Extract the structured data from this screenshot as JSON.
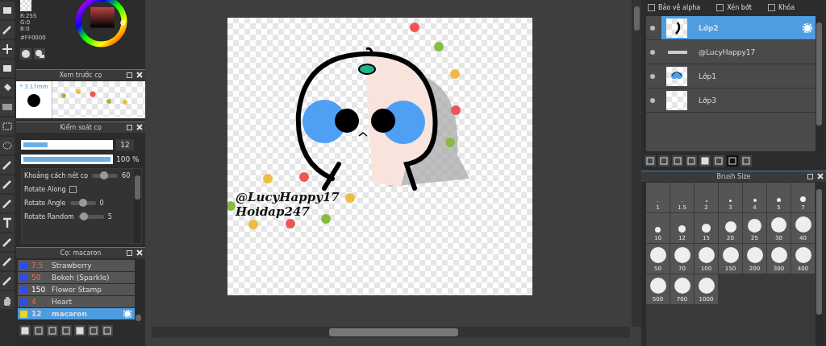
{
  "color": {
    "r": "R:255",
    "g": "G:0",
    "b": "B:0",
    "hex": "#FF0000"
  },
  "brush_preview": {
    "title": "Xem trước cọ",
    "size": "* 3.17mm"
  },
  "brush_control": {
    "title": "Kiểm soát cọ",
    "size": {
      "value": "12",
      "level": 0.28
    },
    "opacity": {
      "value": "100 %",
      "level": 1.0
    },
    "settings": [
      {
        "kind": "slider",
        "label": "Khoảng cách nét cọ",
        "value": "60",
        "level": 0.45
      },
      {
        "kind": "checkbox",
        "label": "Rotate Along",
        "checked": false
      },
      {
        "kind": "slider",
        "label": "Rotate Angle",
        "value": "0",
        "level": 0.5
      },
      {
        "kind": "slider",
        "label": "Rotate Random",
        "value": "5",
        "level": 0.1
      }
    ]
  },
  "brushes": {
    "title": "Cọ: macaron",
    "items": [
      {
        "size": "7.5",
        "name": "Strawberry",
        "color": "#2f4ee8",
        "size_marked": true,
        "selected": false
      },
      {
        "size": "50",
        "name": "Bokeh (Sparkle)",
        "color": "#2f4ee8",
        "size_marked": true,
        "selected": false
      },
      {
        "size": "150",
        "name": "Flower Stamp",
        "color": "#2f4ee8",
        "size_marked": false,
        "selected": false
      },
      {
        "size": "4",
        "name": "Heart",
        "color": "#2f4ee8",
        "size_marked": true,
        "selected": false
      },
      {
        "size": "12",
        "name": "macaron",
        "color": "#f2d418",
        "size_marked": true,
        "selected": true
      }
    ]
  },
  "canvas": {
    "texts": [
      "@LucyHappy17",
      "Hoidap247"
    ]
  },
  "layer_options": [
    {
      "label": "Bảo vệ alpha",
      "checked": false
    },
    {
      "label": "Xén bớt",
      "checked": false
    },
    {
      "label": "Khóa",
      "checked": false
    }
  ],
  "layers": [
    {
      "name": "Lớp2",
      "kind": "stroke",
      "selected": true
    },
    {
      "name": "@LucyHappy17",
      "kind": "text",
      "selected": false
    },
    {
      "name": "Lớp1",
      "kind": "face",
      "selected": false
    },
    {
      "name": "Lớp3",
      "kind": "empty",
      "selected": false
    }
  ],
  "brush_size": {
    "title": "Brush Size",
    "sizes": [
      "1",
      "1.5",
      "2",
      "3",
      "4",
      "5",
      "7",
      "10",
      "12",
      "15",
      "20",
      "25",
      "30",
      "40",
      "50",
      "70",
      "100",
      "150",
      "200",
      "300",
      "400",
      "500",
      "700",
      "1000"
    ]
  }
}
